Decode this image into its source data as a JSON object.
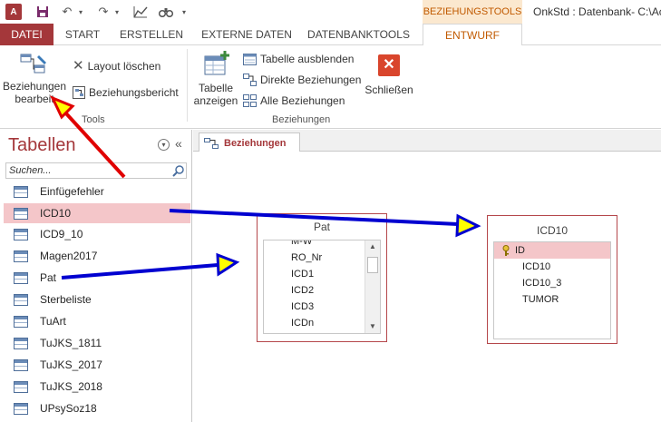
{
  "window": {
    "title": "OnkStd : Datenbank- C:\\Ac",
    "context_tab_group": "BEZIEHUNGSTOOLS"
  },
  "tabs": [
    {
      "label": "DATEI"
    },
    {
      "label": "START"
    },
    {
      "label": "ERSTELLEN"
    },
    {
      "label": "EXTERNE DATEN"
    },
    {
      "label": "DATENBANKTOOLS"
    },
    {
      "label": "ENTWURF"
    }
  ],
  "ribbon": {
    "edit_relationships_l1": "Beziehungen",
    "edit_relationships_l2": "bearbeit",
    "clear_layout": "Layout löschen",
    "relationship_report": "Beziehungsbericht",
    "tools_group": "Tools",
    "show_table_l1": "Tabelle",
    "show_table_l2": "anzeigen",
    "hide_table": "Tabelle ausblenden",
    "direct_relationships": "Direkte Beziehungen",
    "all_relationships": "Alle Beziehungen",
    "close": "Schließen",
    "relationships_group": "Beziehungen"
  },
  "nav": {
    "title": "Tabellen",
    "search_placeholder": "Suchen...",
    "items": [
      {
        "label": "Einfügefehler"
      },
      {
        "label": "ICD10"
      },
      {
        "label": "ICD9_10"
      },
      {
        "label": "Magen2017"
      },
      {
        "label": "Pat"
      },
      {
        "label": "Sterbeliste"
      },
      {
        "label": "TuArt"
      },
      {
        "label": "TuJKS_1811"
      },
      {
        "label": "TuJKS_2017"
      },
      {
        "label": "TuJKS_2018"
      },
      {
        "label": "UPsySoz18"
      }
    ]
  },
  "doc": {
    "tab_label": "Beziehungen",
    "pat_table": {
      "title": "Pat",
      "fields": [
        "M-W",
        "RO_Nr",
        "ICD1",
        "ICD2",
        "ICD3",
        "ICDn"
      ]
    },
    "icd10_table": {
      "title": "ICD10",
      "fields": [
        "ID",
        "ICD10",
        "ICD10_3",
        "TUMOR"
      ]
    }
  },
  "colors": {
    "accent": "#a4373a",
    "context": "#c15a00",
    "selection": "#f4c6c9",
    "annotation_arrow_blue": "#0000d0",
    "annotation_arrow_red": "#e00000",
    "annotation_arrowhead_fill": "#ffff00"
  }
}
